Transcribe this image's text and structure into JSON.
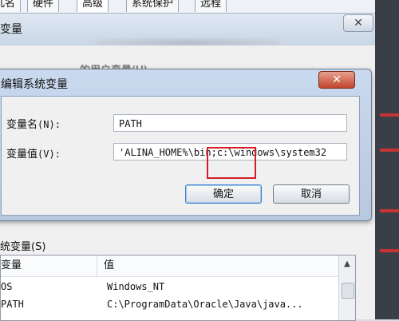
{
  "tabs": [
    "几名",
    "硬件",
    "高级",
    "系统保护",
    "远程"
  ],
  "background_window": {
    "title": "变量",
    "user_vars_label": "的用户变量(U)",
    "close_icon": "close-icon",
    "system_vars_label": "统变量(S)",
    "system_vars_columns": [
      "变量",
      "值"
    ],
    "system_vars_rows": [
      {
        "name": "OS",
        "value": "Windows_NT"
      },
      {
        "name": "PATH",
        "value": "C:\\ProgramData\\Oracle\\Java\\java..."
      }
    ]
  },
  "dialog": {
    "title": "编辑系统变量",
    "close_glyph": "✕",
    "var_name_label": "变量名",
    "var_name_hint": "(N):",
    "var_name_value": "PATH",
    "var_value_label": "变量值",
    "var_value_hint": "(V):",
    "var_value_value": "'ALINA_HOME%\\bin;c:\\windows\\system32",
    "ok_label": "确定",
    "cancel_label": "取消"
  },
  "colors": {
    "annotation_red": "#d21f27",
    "close_button_red": "#c2452c"
  }
}
